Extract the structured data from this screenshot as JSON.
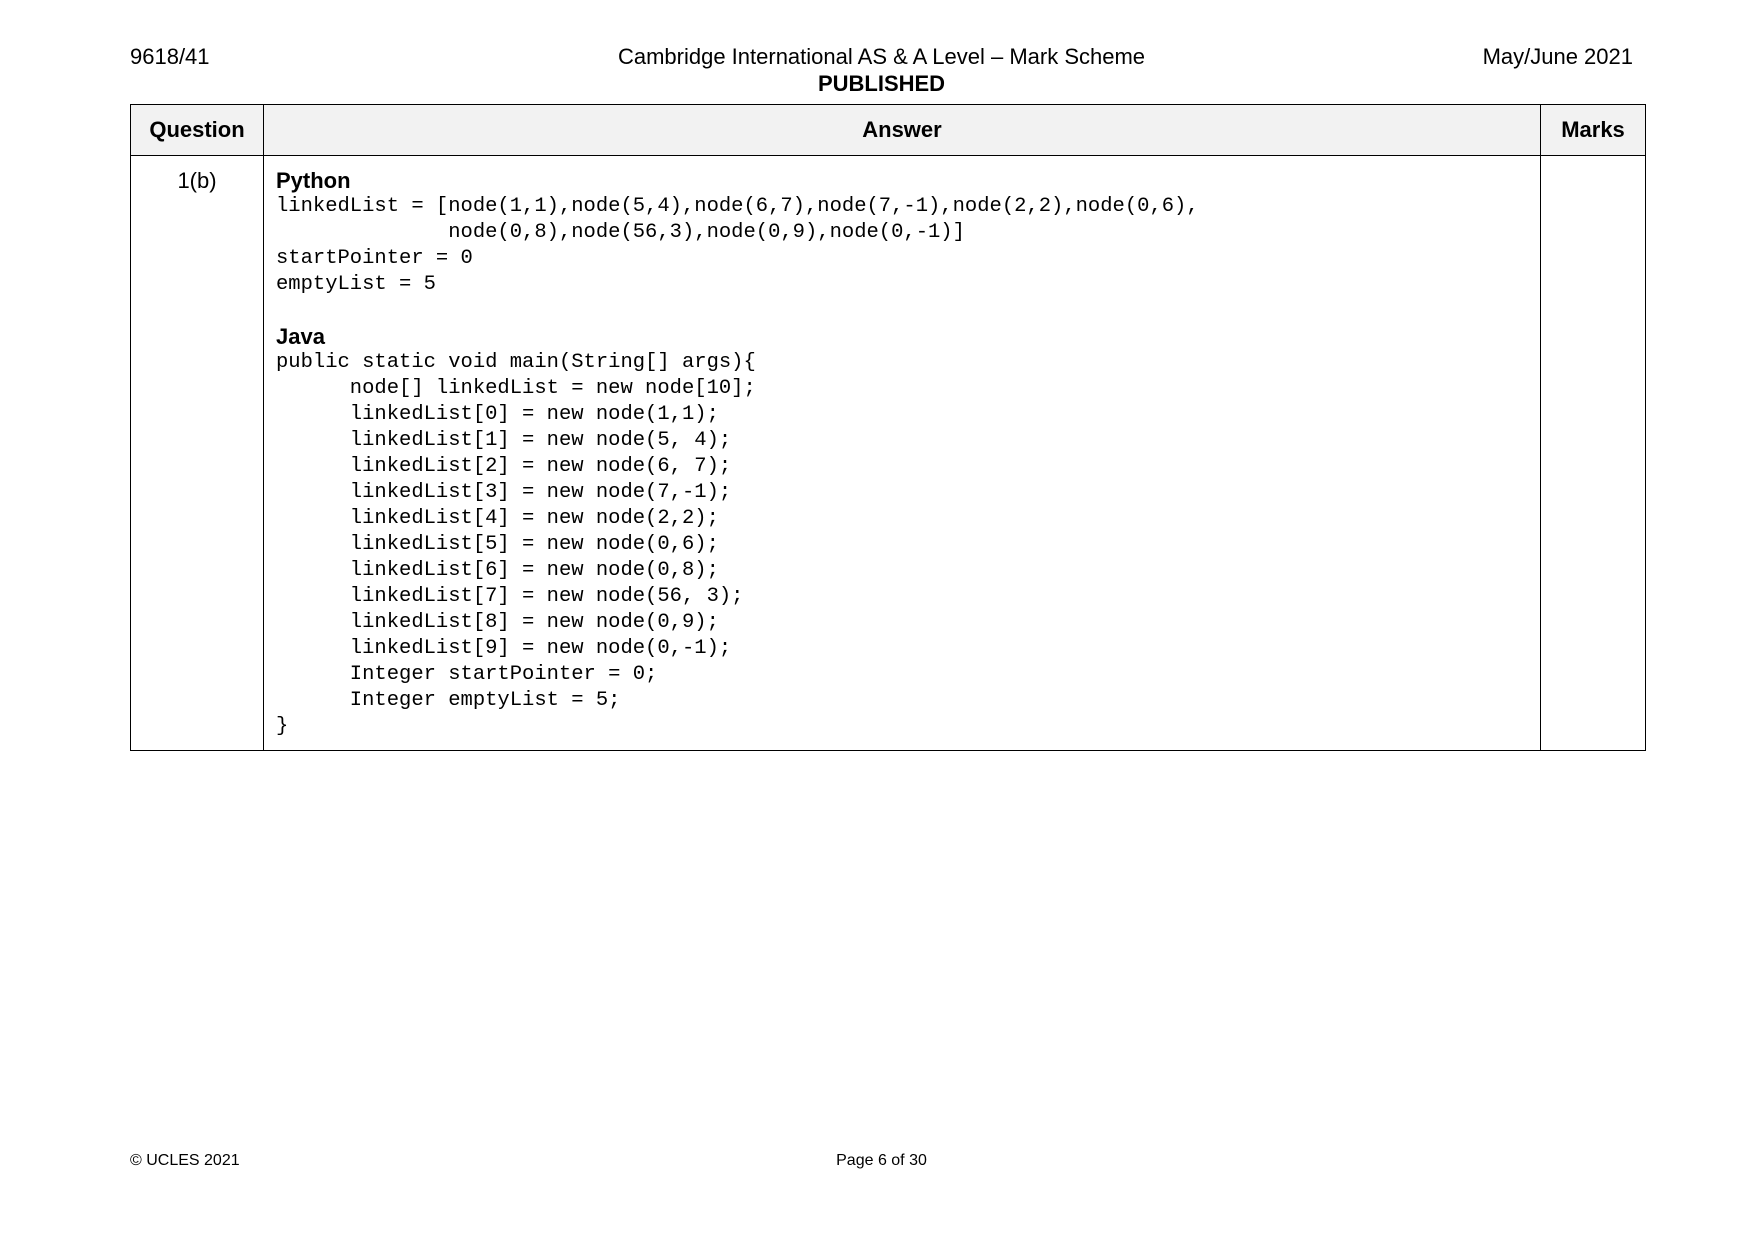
{
  "header": {
    "code": "9618/41",
    "title": "Cambridge International AS & A Level – Mark Scheme",
    "status": "PUBLISHED",
    "session": "May/June 2021"
  },
  "table": {
    "headers": {
      "question": "Question",
      "answer": "Answer",
      "marks": "Marks"
    },
    "row": {
      "question": "1(b)",
      "marks": "",
      "python": {
        "label": "Python",
        "lines": [
          "linkedList = [node(1,1),node(5,4),node(6,7),node(7,-1),node(2,2),node(0,6),",
          "              node(0,8),node(56,3),node(0,9),node(0,-1)]",
          "startPointer = 0",
          "emptyList = 5"
        ]
      },
      "java": {
        "label": "Java",
        "lines": [
          "public static void main(String[] args){",
          "      node[] linkedList = new node[10];",
          "      linkedList[0] = new node(1,1);",
          "      linkedList[1] = new node(5, 4);",
          "      linkedList[2] = new node(6, 7);",
          "      linkedList[3] = new node(7,-1);",
          "      linkedList[4] = new node(2,2);",
          "      linkedList[5] = new node(0,6);",
          "      linkedList[6] = new node(0,8);",
          "      linkedList[7] = new node(56, 3);",
          "      linkedList[8] = new node(0,9);",
          "      linkedList[9] = new node(0,-1);",
          "      Integer startPointer = 0;",
          "      Integer emptyList = 5;",
          "}"
        ]
      }
    }
  },
  "footer": {
    "copyright": "© UCLES 2021",
    "page": "Page 6 of 30"
  }
}
